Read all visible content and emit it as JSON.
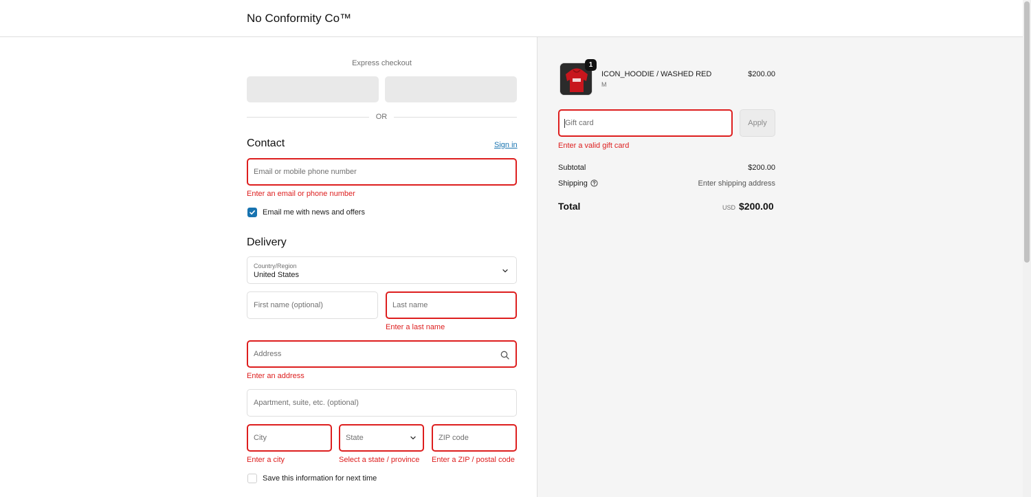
{
  "header": {
    "brand": "No Conformity Co™"
  },
  "express": {
    "title": "Express checkout",
    "divider": "OR"
  },
  "contact": {
    "title": "Contact",
    "sign_in": "Sign in",
    "email_placeholder": "Email or mobile phone number",
    "email_error": "Enter an email or phone number",
    "newsletter_label": "Email me with news and offers",
    "newsletter_checked": true
  },
  "delivery": {
    "title": "Delivery",
    "country_label": "Country/Region",
    "country_value": "United States",
    "first_name_placeholder": "First name (optional)",
    "last_name_placeholder": "Last name",
    "last_name_error": "Enter a last name",
    "address_placeholder": "Address",
    "address_error": "Enter an address",
    "apartment_placeholder": "Apartment, suite, etc. (optional)",
    "city_placeholder": "City",
    "city_error": "Enter a city",
    "state_placeholder": "State",
    "state_error": "Select a state / province",
    "zip_placeholder": "ZIP code",
    "zip_error": "Enter a ZIP / postal code",
    "save_info_label": "Save this information for next time",
    "save_info_checked": false
  },
  "order": {
    "item": {
      "quantity": "1",
      "name": "ICON_HOODIE / WASHED RED",
      "variant": "M",
      "price": "$200.00"
    },
    "gift_card_placeholder": "Gift card",
    "apply_label": "Apply",
    "gift_card_error": "Enter a valid gift card",
    "subtotal_label": "Subtotal",
    "subtotal_value": "$200.00",
    "shipping_label": "Shipping",
    "shipping_value": "Enter shipping address",
    "total_label": "Total",
    "currency": "USD",
    "total_value": "$200.00"
  },
  "colors": {
    "error": "#dd1d1d",
    "link": "#1773b0",
    "sidebar_bg": "#f5f5f5"
  },
  "icons": {
    "check": "checkmark-icon",
    "chevron": "chevron-down-icon",
    "search": "search-icon",
    "help": "help-circle-icon"
  }
}
